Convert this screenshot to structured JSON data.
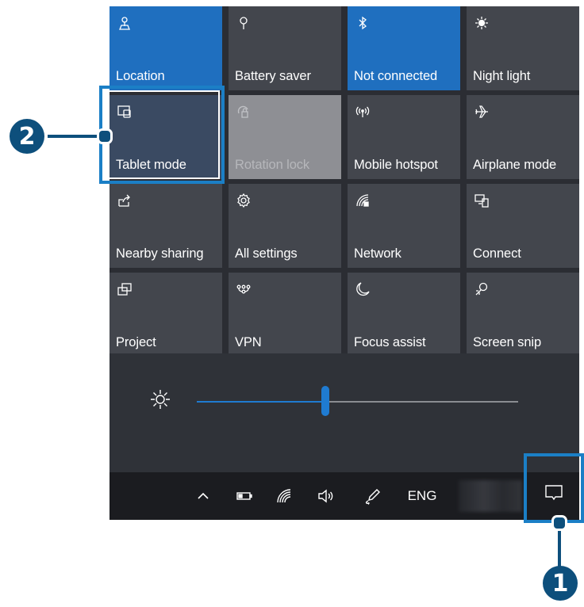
{
  "tiles": [
    {
      "label": "Location",
      "icon": "location-icon",
      "state": "active"
    },
    {
      "label": "Battery saver",
      "icon": "battery-saver-icon",
      "state": "normal"
    },
    {
      "label": "Not connected",
      "icon": "bluetooth-icon",
      "state": "active"
    },
    {
      "label": "Night light",
      "icon": "night-light-icon",
      "state": "normal"
    },
    {
      "label": "Tablet mode",
      "icon": "tablet-mode-icon",
      "state": "normal"
    },
    {
      "label": "Rotation lock",
      "icon": "rotation-lock-icon",
      "state": "disabled"
    },
    {
      "label": "Mobile hotspot",
      "icon": "mobile-hotspot-icon",
      "state": "normal"
    },
    {
      "label": "Airplane mode",
      "icon": "airplane-icon",
      "state": "normal"
    },
    {
      "label": "Nearby sharing",
      "icon": "nearby-sharing-icon",
      "state": "normal"
    },
    {
      "label": "All settings",
      "icon": "gear-icon",
      "state": "normal"
    },
    {
      "label": "Network",
      "icon": "network-icon",
      "state": "normal"
    },
    {
      "label": "Connect",
      "icon": "connect-icon",
      "state": "normal"
    },
    {
      "label": "Project",
      "icon": "project-icon",
      "state": "normal"
    },
    {
      "label": "VPN",
      "icon": "vpn-icon",
      "state": "normal"
    },
    {
      "label": "Focus assist",
      "icon": "moon-icon",
      "state": "normal"
    },
    {
      "label": "Screen snip",
      "icon": "screen-snip-icon",
      "state": "normal"
    }
  ],
  "brightness": {
    "level_percent": 40,
    "icon": "brightness-icon"
  },
  "taskbar": {
    "icons": [
      "chevron-up-icon",
      "battery-icon",
      "wifi-icon",
      "volume-icon",
      "pen-icon"
    ],
    "language": "ENG",
    "action_center_icon": "action-center-icon"
  },
  "callouts": {
    "one": "1",
    "two": "2"
  },
  "colors": {
    "accent": "#1f6fbf",
    "tile": "#43464d",
    "panel": "#2b2d33",
    "callout": "#0d4f7c"
  }
}
